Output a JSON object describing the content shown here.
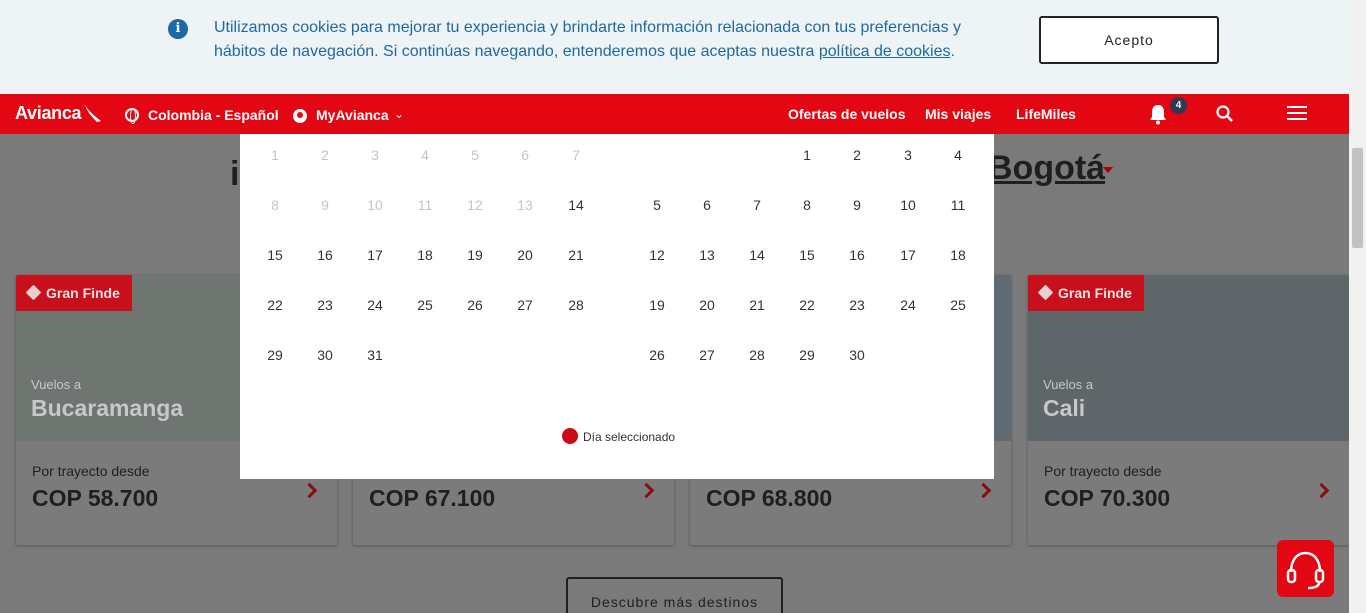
{
  "cookie_banner": {
    "text": "Utilizamos cookies para mejorar tu experiencia y brindarte información relacionada con tus preferencias y hábitos de navegación. Si continúas navegando, entenderemos que aceptas nuestra ",
    "link": "política de cookies",
    "text_end": ".",
    "accept_label": "Acepto"
  },
  "nav": {
    "logo": "Avianca",
    "country": "Colombia - Español",
    "myavianca": "MyAvianca",
    "links": [
      "Ofertas de vuelos",
      "Mis viajes",
      "LifeMiles"
    ],
    "notifications_count": "4"
  },
  "headline": {
    "left": "i",
    "city": "Bogotá"
  },
  "calendar": {
    "month1": {
      "rows": [
        [
          "1",
          "2",
          "3",
          "4",
          "5",
          "6",
          "7"
        ],
        [
          "8",
          "9",
          "10",
          "11",
          "12",
          "13",
          "14"
        ],
        [
          "15",
          "16",
          "17",
          "18",
          "19",
          "20",
          "21"
        ],
        [
          "22",
          "23",
          "24",
          "25",
          "26",
          "27",
          "28"
        ],
        [
          "29",
          "30",
          "31"
        ]
      ],
      "disabled_through": 13
    },
    "month2": {
      "rows": [
        [
          "",
          "",
          "",
          "1",
          "2",
          "3",
          "4"
        ],
        [
          "5",
          "6",
          "7",
          "8",
          "9",
          "10",
          "11"
        ],
        [
          "12",
          "13",
          "14",
          "15",
          "16",
          "17",
          "18"
        ],
        [
          "19",
          "20",
          "21",
          "22",
          "23",
          "24",
          "25"
        ],
        [
          "26",
          "27",
          "28",
          "29",
          "30"
        ]
      ]
    },
    "legend": "Día seleccionado"
  },
  "cards": [
    {
      "tag": "Gran Finde",
      "vuelos": "Vuelos a",
      "city": "Bucaramanga",
      "desde": "Por trayecto desde",
      "price": "COP 58.700",
      "image_color": "#6f7672"
    },
    {
      "tag": "",
      "vuelos": "",
      "city": "",
      "desde": "",
      "price": "COP 67.100",
      "image_color": "#6e7377"
    },
    {
      "tag": "",
      "vuelos": "",
      "city": "",
      "desde": "",
      "price": "COP 68.800",
      "image_color": "#5f6a73"
    },
    {
      "tag": "Gran Finde",
      "vuelos": "Vuelos a",
      "city": "Cali",
      "desde": "Por trayecto desde",
      "price": "COP 70.300",
      "image_color": "#5f666a"
    }
  ],
  "more_button": "Descubre más destinos",
  "colors": {
    "brand_red": "#e30613",
    "info_blue": "#1b6aa8"
  }
}
